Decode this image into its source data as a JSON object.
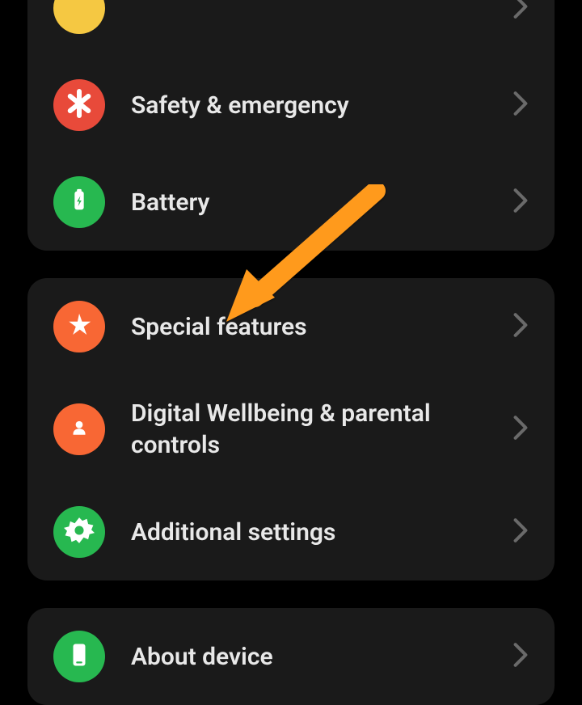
{
  "groups": [
    {
      "items": [
        {
          "label": ""
        },
        {
          "label": "Safety & emergency"
        },
        {
          "label": "Battery"
        }
      ]
    },
    {
      "items": [
        {
          "label": "Special features"
        },
        {
          "label": "Digital Wellbeing & parental controls"
        },
        {
          "label": "Additional settings"
        }
      ]
    },
    {
      "items": [
        {
          "label": "About device"
        }
      ]
    }
  ],
  "colors": {
    "yellow": "#f5c842",
    "red": "#e84a3a",
    "green": "#27b850",
    "orange": "#f86734",
    "arrow": "#ff9a1f"
  }
}
